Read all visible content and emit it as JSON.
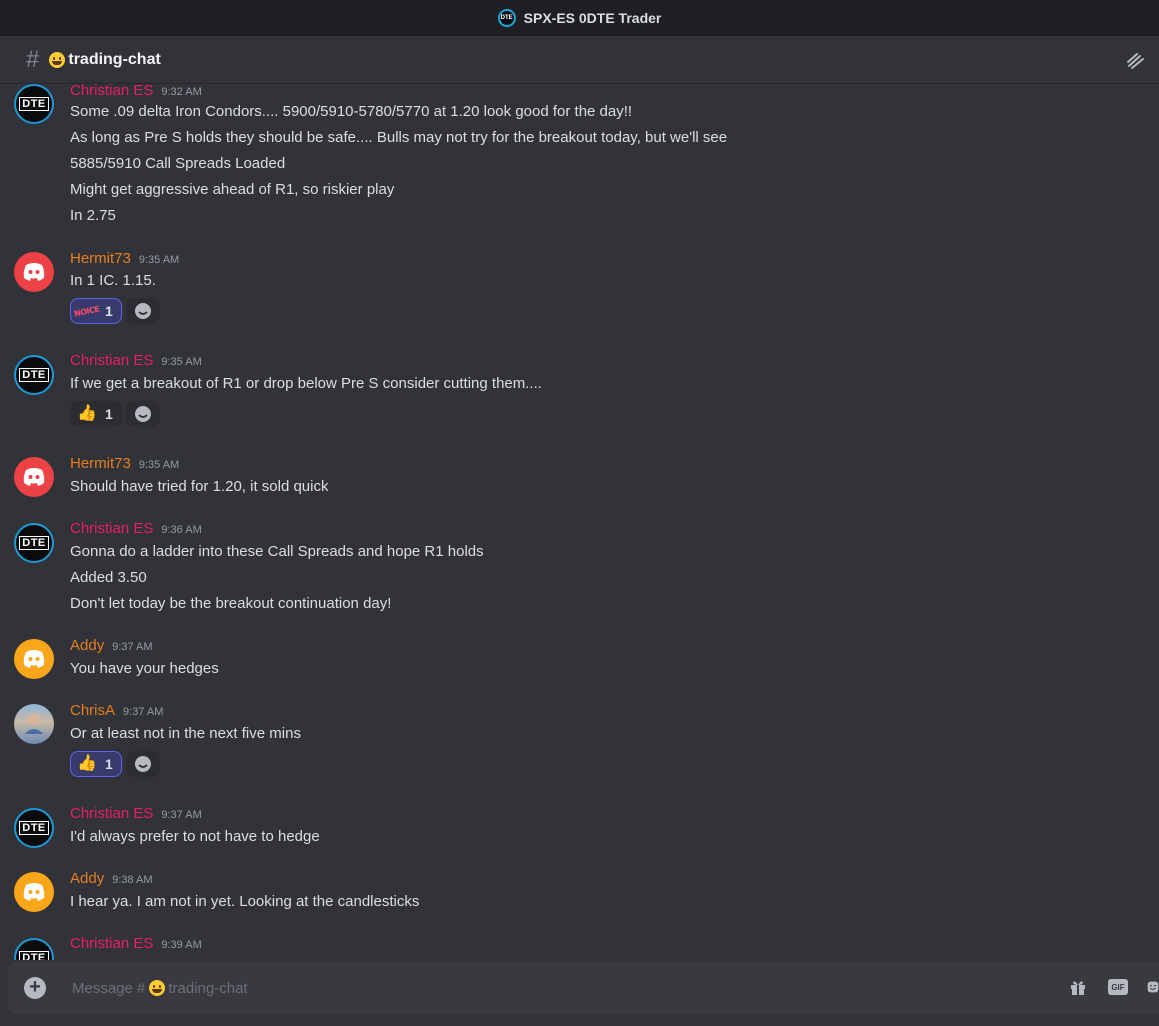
{
  "window": {
    "title": "SPX-ES 0DTE Trader",
    "server_icon_text": "DTE"
  },
  "channel": {
    "name": "trading-chat"
  },
  "avatar_text": "DTE",
  "messages": [
    {
      "author": "Christian ES",
      "time": "9:32 AM",
      "lines": [
        "Some .09 delta Iron Condors....  5900/5910-5780/5770 at 1.20 look good for the day!!",
        "As long as Pre S holds they should be safe.... Bulls may not try for the breakout today, but we'll see",
        "5885/5910 Call Spreads Loaded",
        "Might get aggressive ahead of R1, so riskier play",
        "In 2.75"
      ]
    },
    {
      "author": "Hermit73",
      "time": "9:35 AM",
      "lines": [
        "In 1 IC.  1.15."
      ],
      "reactions": [
        {
          "emoji": "NOICE",
          "count": "1"
        }
      ]
    },
    {
      "author": "Christian ES",
      "time": "9:35 AM",
      "lines": [
        "If we get a breakout of R1 or drop below Pre S consider cutting them...."
      ],
      "reactions": [
        {
          "emoji": "👍",
          "count": "1"
        }
      ]
    },
    {
      "author": "Hermit73",
      "time": "9:35 AM",
      "lines": [
        "Should have tried for 1.20, it sold quick"
      ]
    },
    {
      "author": "Christian ES",
      "time": "9:36 AM",
      "lines": [
        "Gonna do a ladder into these Call Spreads and hope R1 holds",
        "Added 3.50",
        "Don't let today be the breakout continuation day!"
      ]
    },
    {
      "author": "Addy",
      "time": "9:37 AM",
      "lines": [
        "You have your hedges"
      ]
    },
    {
      "author": "ChrisA",
      "time": "9:37 AM",
      "lines": [
        "Or at least not in the next five mins"
      ],
      "reactions": [
        {
          "emoji": "👍",
          "count": "1"
        }
      ]
    },
    {
      "author": "Christian ES",
      "time": "9:37 AM",
      "lines": [
        "I'd always prefer to not have to hedge"
      ]
    },
    {
      "author": "Addy",
      "time": "9:38 AM",
      "lines": [
        "I hear ya.  I am not in yet.  Looking at the candlesticks"
      ]
    },
    {
      "author": "Christian ES",
      "time": "9:39 AM",
      "lines": []
    }
  ],
  "composer": {
    "placeholder_prefix": "Message #",
    "placeholder_channel": "trading-chat",
    "gif_label": "GIF"
  },
  "colors": {
    "background": "#313338",
    "christian": "#e91e63",
    "others": "#e67e22",
    "discord_red": "#ed4245",
    "discord_orange": "#faa61a"
  }
}
